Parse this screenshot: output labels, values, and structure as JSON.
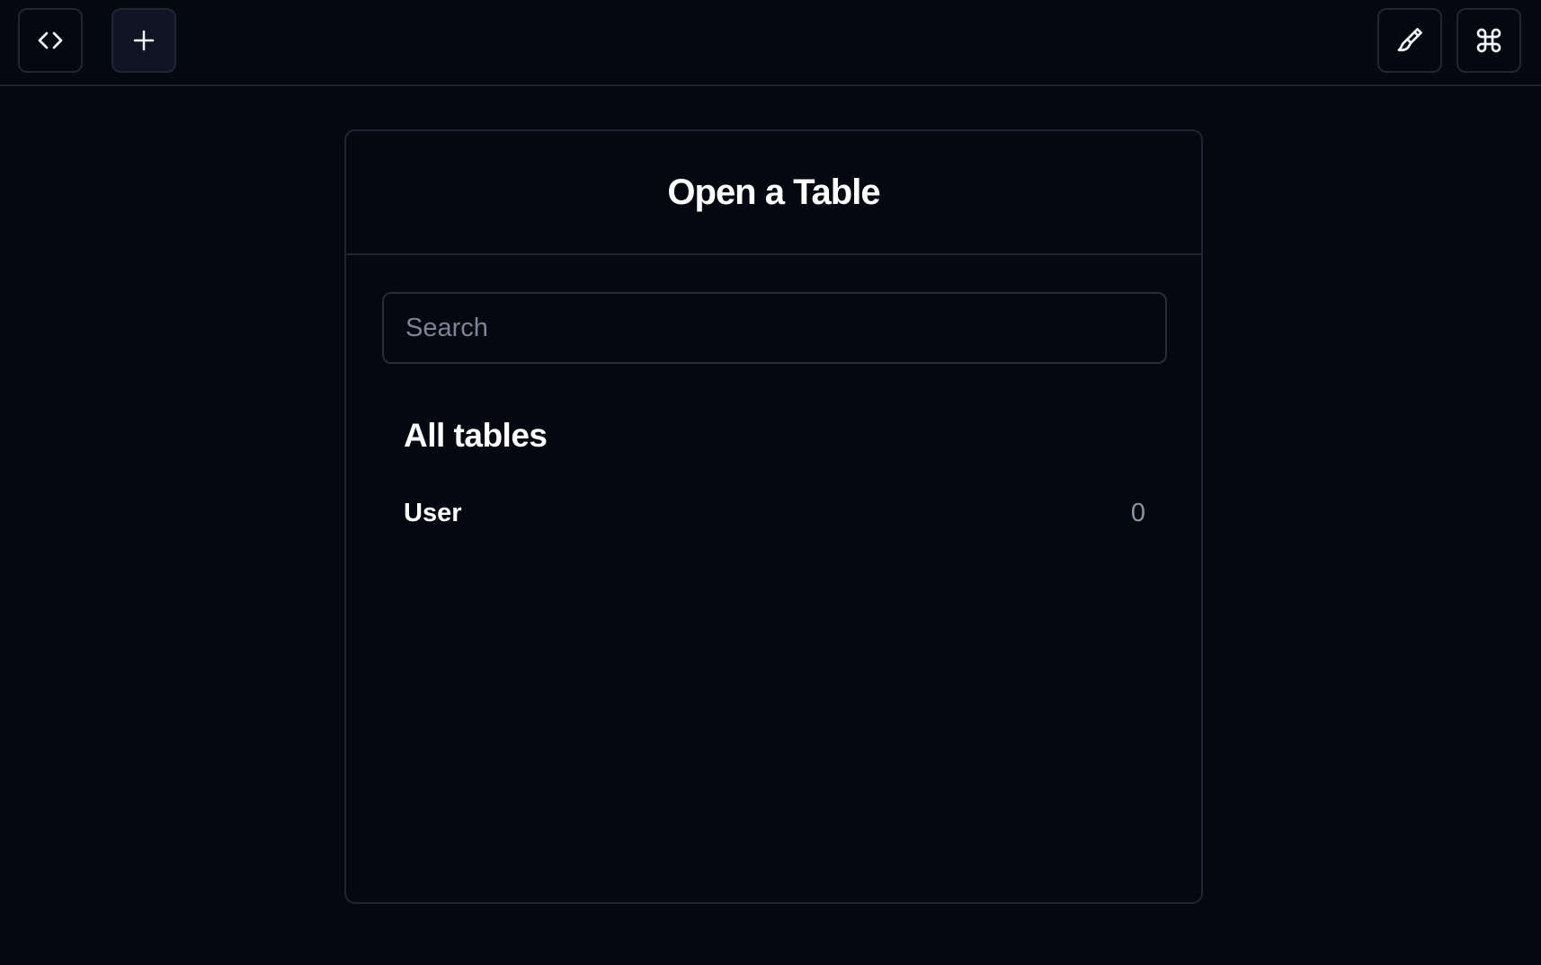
{
  "toolbar": {
    "left_buttons": [
      {
        "icon": "code-icon"
      },
      {
        "icon": "plus-icon"
      }
    ],
    "right_buttons": [
      {
        "icon": "paintbrush-icon"
      },
      {
        "icon": "command-icon"
      }
    ]
  },
  "dialog": {
    "title": "Open a Table",
    "search": {
      "placeholder": "Search",
      "value": ""
    },
    "section_title": "All tables",
    "tables": [
      {
        "name": "User",
        "count": "0"
      }
    ]
  },
  "colors": {
    "background": "#050711",
    "border": "#1f2533",
    "text": "#ffffff",
    "muted": "#8a93a6"
  }
}
